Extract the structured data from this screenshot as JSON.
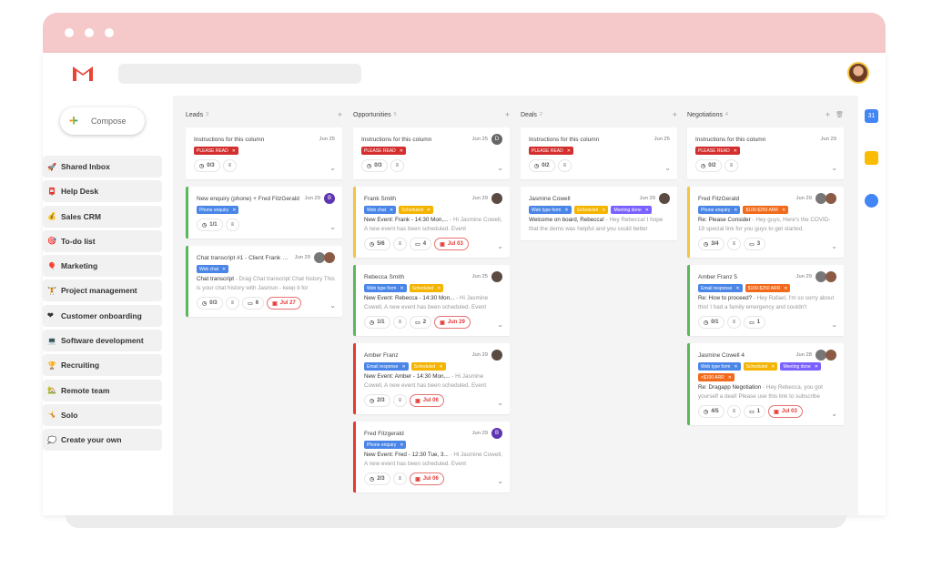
{
  "app": {
    "compose_label": "Compose",
    "search_placeholder": ""
  },
  "sidebar": {
    "items": [
      {
        "icon": "🚀",
        "label": "Shared Inbox"
      },
      {
        "icon": "📮",
        "label": "Help Desk"
      },
      {
        "icon": "💰",
        "label": "Sales CRM"
      },
      {
        "icon": "🎯",
        "label": "To-do list"
      },
      {
        "icon": "🎈",
        "label": "Marketing"
      },
      {
        "icon": "🏋",
        "label": "Project management"
      },
      {
        "icon": "❤",
        "label": "Customer onboarding"
      },
      {
        "icon": "💻",
        "label": "Software development"
      },
      {
        "icon": "🏆",
        "label": "Recruiting"
      },
      {
        "icon": "🏡",
        "label": "Remote team"
      },
      {
        "icon": "🤸",
        "label": "Solo"
      },
      {
        "icon": "💭",
        "label": "Create your own"
      }
    ]
  },
  "colors": {
    "tag_red": "#d32f2f",
    "tag_blue": "#4a86e8",
    "tag_yellow": "#f4b400",
    "tag_purple": "#7b61ff",
    "tag_orange": "#f26a1b",
    "border_green": "#5cb85c",
    "border_yellow": "#f4c542",
    "border_red": "#e53935"
  },
  "columns": [
    {
      "title": "Leads",
      "count": "3",
      "cards": [
        {
          "title": "Instructions for this column",
          "date": "Jun 25",
          "tags": [
            {
              "label": "PLEASE READ",
              "color": "red"
            }
          ],
          "checks": "0/3"
        },
        {
          "title": "New enquiry (phone) + Fred FitzGerald",
          "date": "Jun 29",
          "avatar": "B",
          "border": "green",
          "tags": [
            {
              "label": "Phone enquiry",
              "color": "blue"
            }
          ],
          "checks": "1/1"
        },
        {
          "title": "Chat transcript #1 - Client Frank Le...",
          "date": "Jun 29",
          "avatar": "photos",
          "border": "green",
          "tags": [
            {
              "label": "Web chat",
              "color": "blue"
            }
          ],
          "subject": "Chat transcript",
          "preview": " - Drag Chat transcript Chat history This is your chat history with Jasmun - keep it for",
          "checks": "0/3",
          "comments": "6",
          "due": "Jul 27"
        }
      ]
    },
    {
      "title": "Opportunities",
      "count": "5",
      "cards": [
        {
          "title": "Instructions for this column",
          "date": "Jun 25",
          "avatar": "D",
          "tags": [
            {
              "label": "PLEASE READ",
              "color": "red"
            }
          ],
          "checks": "0/3"
        },
        {
          "title": "Frank Smith",
          "date": "Jun 29",
          "avatar": "photo",
          "border": "yellow",
          "tags": [
            {
              "label": "Web chat",
              "color": "blue"
            },
            {
              "label": "Scheduled",
              "color": "yellow"
            }
          ],
          "subject": "New Event: Frank - 14:30 Mon,...",
          "preview": " - Hi Jasmine Cowell, A new event has been scheduled. Event",
          "checks": "5/6",
          "comments": "4",
          "due": "Jul 03"
        },
        {
          "title": "Rebecca Smith",
          "date": "Jun 25",
          "avatar": "photo",
          "border": "green",
          "tags": [
            {
              "label": "Web type form",
              "color": "blue"
            },
            {
              "label": "Scheduled",
              "color": "yellow"
            }
          ],
          "subject": "New Event: Rebecca - 14:30 Mon...",
          "preview": " - Hi Jasmine Cowell, A new event has been scheduled. Event",
          "checks": "1/1",
          "comments": "2",
          "due": "Jun 29"
        },
        {
          "title": "Amber Franz",
          "date": "Jun 29",
          "avatar": "photo",
          "border": "red",
          "tags": [
            {
              "label": "Email response",
              "color": "blue"
            },
            {
              "label": "Scheduled",
              "color": "yellow"
            }
          ],
          "subject": "New Event: Amber - 14:30 Mon,...",
          "preview": " - Hi Jasmine Cowell, A new event has been scheduled. Event",
          "checks": "2/3",
          "due": "Jul 06"
        },
        {
          "title": "Fred Fitzgerald",
          "date": "Jun 29",
          "avatar": "B",
          "border": "red",
          "tags": [
            {
              "label": "Phone enquiry",
              "color": "blue"
            }
          ],
          "subject": "New Event: Fred - 12:30 Tue, 3...",
          "preview": " - Hi Jasmine Cowell, A new event has been scheduled. Event",
          "checks": "2/3",
          "due": "Jul 06"
        }
      ]
    },
    {
      "title": "Deals",
      "count": "2",
      "cards": [
        {
          "title": "Instructions for this column",
          "date": "Jun 25",
          "tags": [
            {
              "label": "PLEASE READ",
              "color": "red"
            }
          ],
          "checks": "0/2"
        },
        {
          "title": "Jasmine Cowell",
          "date": "Jun 29",
          "avatar": "photo",
          "tags": [
            {
              "label": "Web type form",
              "color": "blue"
            },
            {
              "label": "Scheduled",
              "color": "yellow"
            },
            {
              "label": "Meeting done",
              "color": "purple"
            }
          ],
          "subject": "Welcome on board, Rebecca!",
          "preview": " - Hey Rebecca! I hope that the demo was helpful and you could better",
          "nofoot": true
        }
      ]
    },
    {
      "title": "Negotiations",
      "count": "4",
      "cards": [
        {
          "title": "Instructions for this column",
          "date": "Jun 29",
          "tags": [
            {
              "label": "PLEASE READ",
              "color": "red"
            }
          ],
          "checks": "0/2"
        },
        {
          "title": "Fred FitzGerald",
          "date": "Jun 29",
          "avatar": "photos",
          "border": "yellow",
          "tags": [
            {
              "label": "Phone enquiry",
              "color": "blue"
            },
            {
              "label": "$100-$250 ARR",
              "color": "orange"
            }
          ],
          "subject": "Re: Please Consider",
          "preview": " - Hey guys, Here's the COVID-19 special link for you guys to get started.",
          "checks": "3/4",
          "comments": "3"
        },
        {
          "title": "Amber Franz 5",
          "date": "Jun 29",
          "avatar": "photos",
          "border": "green",
          "tags": [
            {
              "label": "Email response",
              "color": "blue"
            },
            {
              "label": "$100-$250 ARR",
              "color": "orange"
            }
          ],
          "subject": "Re: How to proceed?",
          "preview": " - Hey Rafael, I'm so sorry about this! I had a family emergency and couldn't",
          "checks": "0/1",
          "comments": "1"
        },
        {
          "title": "Jasmine Cowell 4",
          "date": "Jun 28",
          "avatar": "photos",
          "border": "green",
          "tags": [
            {
              "label": "Web type form",
              "color": "blue"
            },
            {
              "label": "Scheduled",
              "color": "yellow"
            },
            {
              "label": "Meeting done",
              "color": "purple"
            },
            {
              "label": "<$100 ARR",
              "color": "orange"
            }
          ],
          "subject": "Re: Dragapp Negotiation",
          "preview": " - Hey Rebecca, you got yourself a deal! Please use this link to subscribe",
          "checks": "4/5",
          "comments": "1",
          "due": "Jul 03"
        }
      ]
    }
  ],
  "rail": {
    "calendar_label": "31"
  }
}
